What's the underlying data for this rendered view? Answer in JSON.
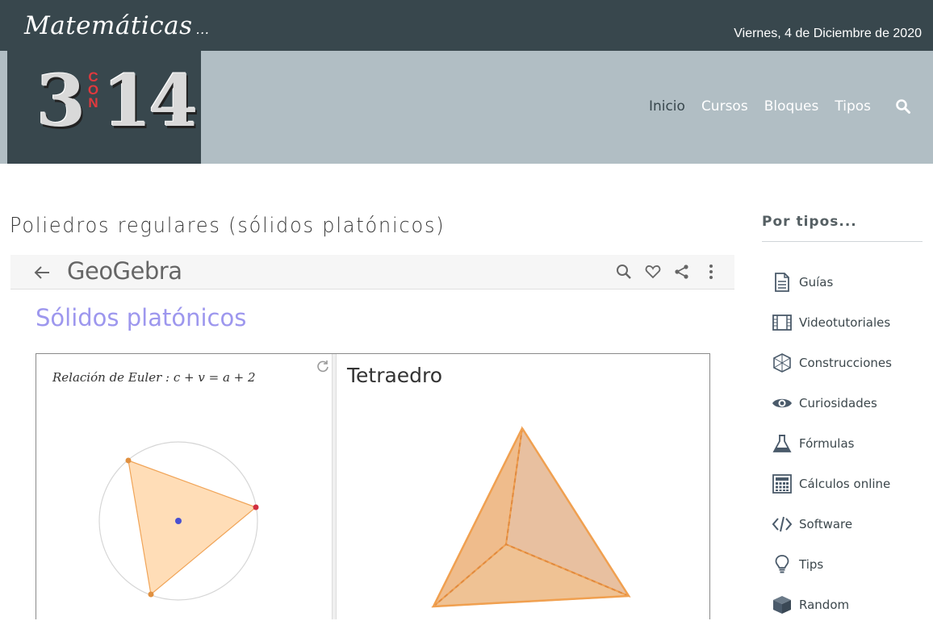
{
  "header": {
    "brand": "Matemáticas",
    "brand_suffix": "...",
    "date": "Viernes, 4 de Diciembre de 2020",
    "logo": {
      "left": "3",
      "middle": "CON",
      "right": "14"
    }
  },
  "nav": {
    "items": [
      {
        "label": "Inicio",
        "active": true
      },
      {
        "label": "Cursos"
      },
      {
        "label": "Bloques"
      },
      {
        "label": "Tipos"
      }
    ],
    "search_icon": "search-icon"
  },
  "main": {
    "page_title": "Poliedros regulares (sólidos platónicos)",
    "geogebra": {
      "logo": "GeoGebra",
      "title": "Sólidos platónicos",
      "euler": "Relación de Euler :  c + v = a + 2",
      "solid_name": "Tetraedro",
      "colors": {
        "fill": "#ffdcb4",
        "stroke": "#f0a050",
        "title": "#9d97ee"
      }
    }
  },
  "sidebar": {
    "title": "Por tipos...",
    "items": [
      {
        "label": "Guías",
        "icon": "document-icon"
      },
      {
        "label": "Videotutoriales",
        "icon": "film-icon"
      },
      {
        "label": "Construcciones",
        "icon": "construction-icon"
      },
      {
        "label": "Curiosidades",
        "icon": "eye-icon"
      },
      {
        "label": "Fórmulas",
        "icon": "flask-icon"
      },
      {
        "label": "Cálculos online",
        "icon": "calculator-icon"
      },
      {
        "label": "Software",
        "icon": "code-icon"
      },
      {
        "label": "Tips",
        "icon": "lightbulb-icon"
      },
      {
        "label": "Random",
        "icon": "cube-icon"
      }
    ]
  },
  "colors": {
    "header_dark": "#38474d",
    "nav_band": "#b1bec4",
    "accent_red": "#e0393e"
  }
}
